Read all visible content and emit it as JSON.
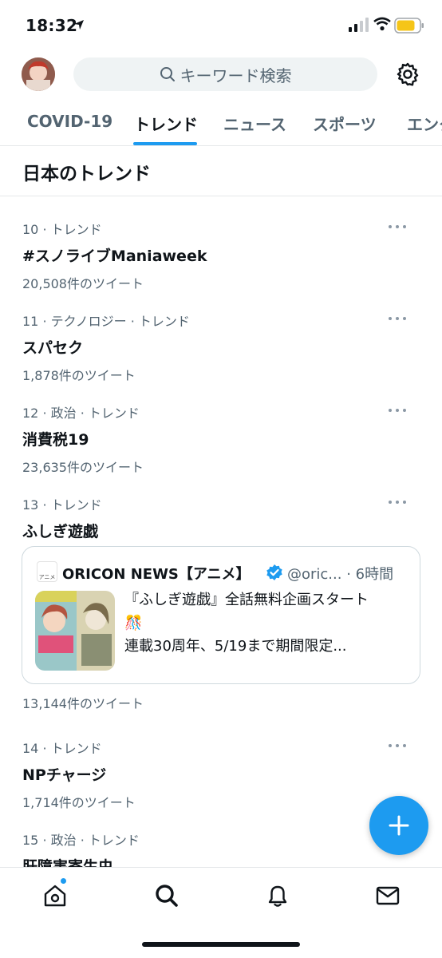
{
  "status_bar": {
    "time": "18:32"
  },
  "search": {
    "placeholder": "キーワード検索"
  },
  "tabs": [
    {
      "label": "COVID-19"
    },
    {
      "label": "トレンド"
    },
    {
      "label": "ニュース"
    },
    {
      "label": "スポーツ"
    },
    {
      "label": "エンタ"
    }
  ],
  "section": {
    "title": "日本のトレンド"
  },
  "trends": [
    {
      "meta": "10 · トレンド",
      "name": "#スノライブManiaweek",
      "count": "20,508件のツイート"
    },
    {
      "meta": "11 · テクノロジー · トレンド",
      "name": "スパセク",
      "count": "1,878件のツイート"
    },
    {
      "meta": "12 · 政治 · トレンド",
      "name": "消費税19",
      "count": "23,635件のツイート"
    },
    {
      "meta": "13 · トレンド",
      "name": "ふしぎ遊戯",
      "count": "13,144件のツイート"
    },
    {
      "meta": "14 · トレンド",
      "name": "NPチャージ",
      "count": "1,714件のツイート"
    },
    {
      "meta": "15 · 政治 · トレンド",
      "name": "肝障害寄生虫",
      "count": ""
    }
  ],
  "news_card": {
    "logo_text": "アニメ",
    "source": "ORICON NEWS【アニメ】",
    "handle_time": "@oric... · 6時間",
    "line1": "『ふしぎ遊戯』全話無料企画スタート",
    "line2": "🎊",
    "line3": "連載30周年、5/19まで期間限定..."
  },
  "colors": {
    "accent": "#1d9bf0",
    "text": "#0f1419",
    "muted": "#536471",
    "border": "#e6e8ea"
  },
  "icons": [
    "location-arrow-icon",
    "signal-icon",
    "wifi-icon",
    "battery-icon",
    "search-icon",
    "gear-icon",
    "more-icon",
    "verified-icon",
    "compose-plus-icon",
    "home-icon",
    "explore-search-icon",
    "bell-icon",
    "mail-icon"
  ]
}
